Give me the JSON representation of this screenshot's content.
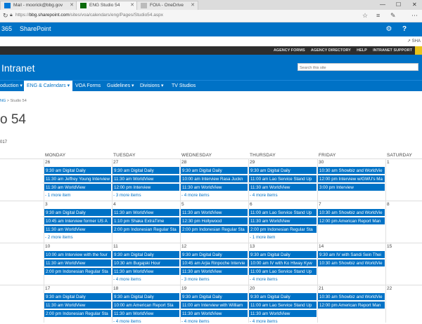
{
  "browser": {
    "tabs": [
      {
        "label": "Mail - moorick@bbg.gov",
        "icon": "mail",
        "color": "#0078d7"
      },
      {
        "label": "ENG Studio 54",
        "icon": "sharepoint",
        "color": "#0b6a0b"
      },
      {
        "label": "FOIA - OneDrive",
        "icon": "page",
        "color": "#888888"
      }
    ],
    "url_host": "bbg.sharepoint.com",
    "url_path": "/sites/voa/calendars/eng/Pages/Studio54.aspx",
    "url_prefix": "https://"
  },
  "suite": {
    "brand": "365",
    "app": "SharePoint",
    "share_label": "SHA"
  },
  "sitebar": {
    "links": [
      "AGENCY FORMS",
      "AGENCY DIRECTORY",
      "HELP",
      "INTRANET SUPPORT"
    ]
  },
  "header": {
    "title": "Intranet",
    "search_placeholder": "Search this site"
  },
  "nav": {
    "items": [
      {
        "label": "oduction ▾"
      },
      {
        "label": "ENG & Calendars ▾"
      },
      {
        "label": "VOA Forms"
      },
      {
        "label": "Guidelines ▾"
      },
      {
        "label": "Divisions ▾"
      },
      {
        "label": "TV Studios"
      }
    ]
  },
  "breadcrumb": {
    "link": "NG",
    "current": " > Studio 54"
  },
  "page": {
    "title": "o 54",
    "year": "017"
  },
  "calendar": {
    "days": [
      "MONDAY",
      "TUESDAY",
      "WEDNESDAY",
      "THURSDAY",
      "FRIDAY",
      "SATURDAY"
    ],
    "weeks": [
      {
        "dates": [
          "26",
          "27",
          "28",
          "29",
          "30",
          "1"
        ],
        "cells": [
          {
            "events": [
              "9:30 am Digital Daily",
              "11:30 am Jeffrey Young Interview",
              "11:30 am WorldView"
            ],
            "more": "- 1 more item"
          },
          {
            "events": [
              "9:30 am Digital Daily",
              "11:30 am WorldView",
              "12:00 pm Interview"
            ],
            "more": "- 3 more items"
          },
          {
            "events": [
              "9:30 am Digital Daily",
              "10:00 am Interview Rasa Juckn",
              "11:30 am WorldView"
            ],
            "more": "- 4 more items"
          },
          {
            "events": [
              "9:30 am Digital Daily",
              "11:00 am Lao Service Stand Up",
              "11:30 am WorldView"
            ],
            "more": "- 4 more items"
          },
          {
            "events": [
              "10:30 am Showbiz and WorldVie",
              "12:00 pm Interview w/GWU's Ma",
              "3:00 pm Interview"
            ],
            "more": ""
          },
          {
            "events": [],
            "more": ""
          }
        ]
      },
      {
        "dates": [
          "3",
          "4",
          "5",
          "6",
          "7",
          "8"
        ],
        "cells": [
          {
            "events": [
              "9:30 am Digital Daily",
              "10:45 am Interview former US A",
              "11:30 am WorldView"
            ],
            "more": "- 2 more items"
          },
          {
            "events": [
              "11:30 am WorldView",
              "1:10 pm Shaka ExtraTime",
              "2:00 pm Indonesian Regular Sta"
            ],
            "more": ""
          },
          {
            "events": [
              "11:30 am WorldView",
              "12:30 pm Hollywood",
              "2:00 pm Indonesian Regular Sta"
            ],
            "more": ""
          },
          {
            "events": [
              "11:00 am Lao Service Stand Up",
              "11:30 am WorldView",
              "2:00 pm Indonesian Regular Sta"
            ],
            "more": "- 1 more item"
          },
          {
            "events": [
              "10:30 am Showbiz and WorldVie",
              "12:00 pm American Report Man"
            ],
            "more": ""
          },
          {
            "events": [],
            "more": ""
          }
        ]
      },
      {
        "dates": [
          "10",
          "11",
          "12",
          "13",
          "14",
          "15"
        ],
        "cells": [
          {
            "events": [
              "10:00 am Interview with the four",
              "11:30 am WorldView",
              "2:00 pm Indonesian Regular Sta"
            ],
            "more": ""
          },
          {
            "events": [
              "9:30 am Digital Daily",
              "10:30 am Bugajski Hour",
              "11:30 am WorldView"
            ],
            "more": "- 4 more items"
          },
          {
            "events": [
              "9:30 am Digital Daily",
              "10:45 am Arjia Rinpoche Intervie",
              "11:30 am WorldView"
            ],
            "more": "- 3 more items"
          },
          {
            "events": [
              "9:30 am Digital Daily",
              "10:00 am IV with Ko Htway Kyw",
              "11:00 am Lao Service Stand Up"
            ],
            "more": "- 4 more items"
          },
          {
            "events": [
              "9:30 am IV with Sandi Sein Thei",
              "10:30 am Showbiz and WorldVie"
            ],
            "more": ""
          },
          {
            "events": [],
            "more": ""
          }
        ]
      },
      {
        "dates": [
          "17",
          "18",
          "19",
          "20",
          "21",
          "22"
        ],
        "cells": [
          {
            "events": [
              "9:30 am Digital Daily",
              "11:30 am WorldView",
              "2:00 pm Indonesian Regular Sta"
            ],
            "more": ""
          },
          {
            "events": [
              "9:30 am Digital Daily",
              "10:00 am American Report Sta",
              "11:30 am WorldView"
            ],
            "more": "- 4 more items"
          },
          {
            "events": [
              "9:30 am Digital Daily",
              "11:00 am Interview with William",
              "11:30 am WorldView"
            ],
            "more": "- 4 more items"
          },
          {
            "events": [
              "9:30 am Digital Daily",
              "11:00 am Lao Service Stand Up",
              "11:30 am WorldView"
            ],
            "more": "- 4 more items"
          },
          {
            "events": [
              "10:30 am Showbiz and WorldVie",
              "12:00 pm American Report Man"
            ],
            "more": ""
          },
          {
            "events": [],
            "more": ""
          }
        ]
      }
    ]
  }
}
